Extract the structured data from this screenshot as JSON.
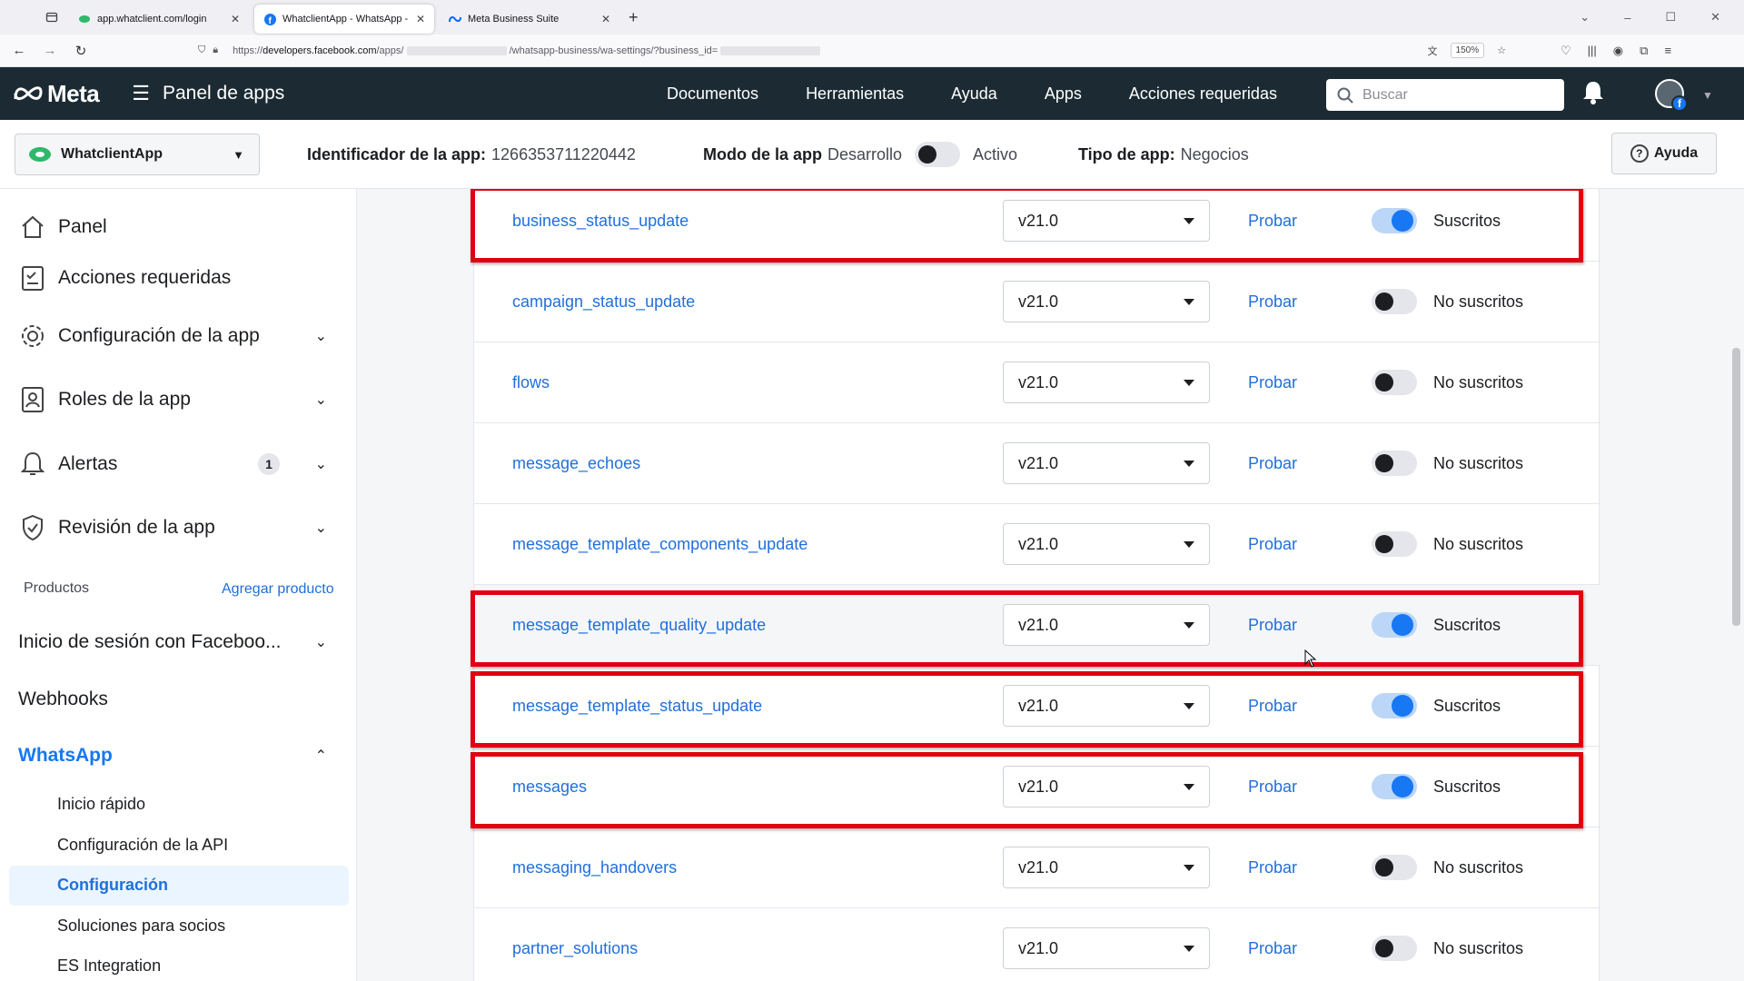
{
  "browser": {
    "tabs": [
      {
        "title": "app.whatclient.com/login",
        "active": false
      },
      {
        "title": "WhatclientApp - WhatsApp - M",
        "active": true
      },
      {
        "title": "Meta Business Suite",
        "active": false
      }
    ],
    "url_prefix": "https://",
    "url_host": "developers.facebook.com",
    "url_path": "/apps/",
    "url_mid": "/whatsapp-business/wa-settings/?business_id=",
    "zoom": "150%"
  },
  "topbar": {
    "logo": "Meta",
    "panel": "Panel de apps",
    "nav": [
      "Documentos",
      "Herramientas",
      "Ayuda",
      "Apps",
      "Acciones requeridas"
    ],
    "search_placeholder": "Buscar"
  },
  "subbar": {
    "app_name": "WhatclientApp",
    "app_id_label": "Identificador de la app:",
    "app_id": "1266353711220442",
    "mode_label": "Modo de la app",
    "mode_dev": "Desarrollo",
    "mode_active": "Activo",
    "type_label": "Tipo de app:",
    "type_value": "Negocios",
    "help": "Ayuda"
  },
  "sidebar": {
    "items": [
      {
        "label": "Panel"
      },
      {
        "label": "Acciones requeridas"
      },
      {
        "label": "Configuración de la app"
      },
      {
        "label": "Roles de la app"
      },
      {
        "label": "Alertas",
        "badge": "1"
      },
      {
        "label": "Revisión de la app"
      }
    ],
    "products_label": "Productos",
    "add_product": "Agregar producto",
    "facebook_login": "Inicio de sesión con Faceboo...",
    "webhooks": "Webhooks",
    "whatsapp": "WhatsApp",
    "whatsapp_sub": [
      "Inicio rápido",
      "Configuración de la API",
      "Configuración",
      "Soluciones para socios",
      "ES Integration"
    ]
  },
  "webhook_fields": {
    "test_label": "Probar",
    "rows": [
      {
        "field": "business_status_update",
        "version": "v21.0",
        "subscribed": true,
        "status": "Suscritos"
      },
      {
        "field": "campaign_status_update",
        "version": "v21.0",
        "subscribed": false,
        "status": "No suscritos"
      },
      {
        "field": "flows",
        "version": "v21.0",
        "subscribed": false,
        "status": "No suscritos"
      },
      {
        "field": "message_echoes",
        "version": "v21.0",
        "subscribed": false,
        "status": "No suscritos"
      },
      {
        "field": "message_template_components_update",
        "version": "v21.0",
        "subscribed": false,
        "status": "No suscritos"
      },
      {
        "field": "message_template_quality_update",
        "version": "v21.0",
        "subscribed": true,
        "status": "Suscritos"
      },
      {
        "field": "message_template_status_update",
        "version": "v21.0",
        "subscribed": true,
        "status": "Suscritos"
      },
      {
        "field": "messages",
        "version": "v21.0",
        "subscribed": true,
        "status": "Suscritos"
      },
      {
        "field": "messaging_handovers",
        "version": "v21.0",
        "subscribed": false,
        "status": "No suscritos"
      },
      {
        "field": "partner_solutions",
        "version": "v21.0",
        "subscribed": false,
        "status": "No suscritos"
      }
    ]
  },
  "colors": {
    "link": "#216fdb",
    "highlight": "#e0000f",
    "toggle_on": "#1877f2",
    "topbar": "#1c2b33"
  }
}
